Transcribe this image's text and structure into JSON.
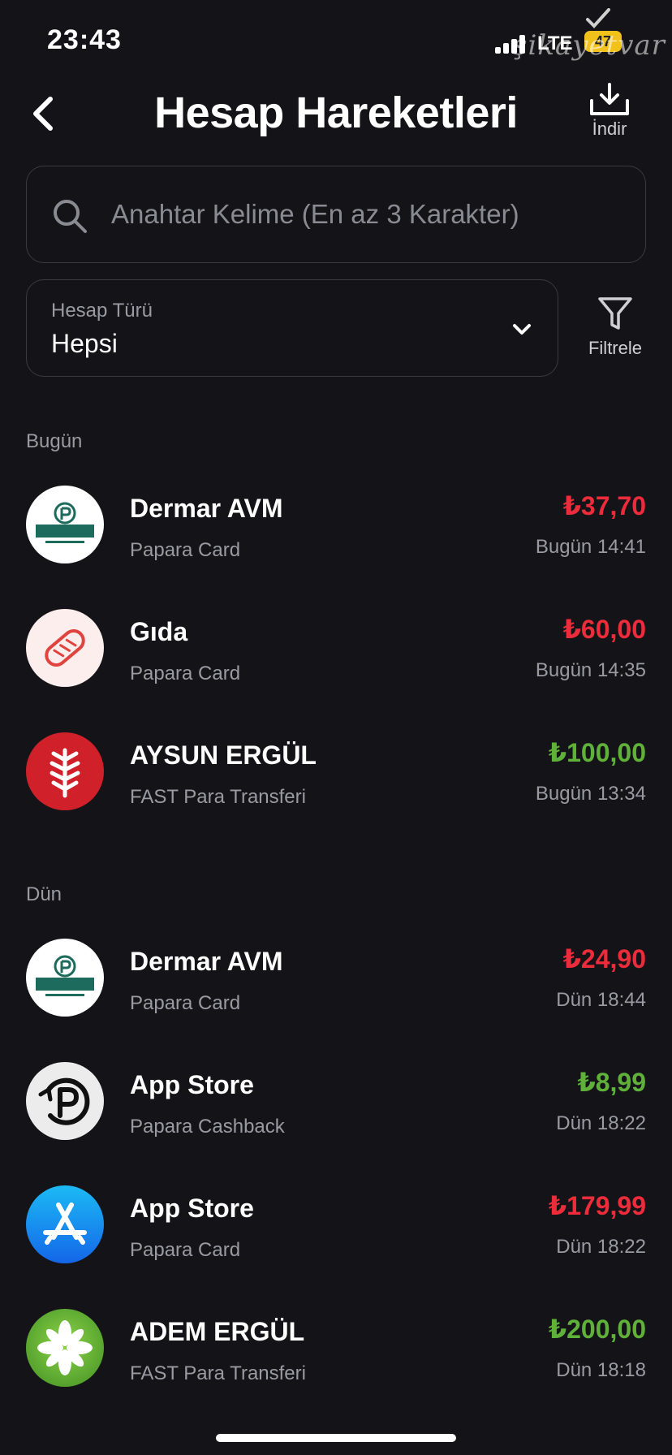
{
  "status_bar": {
    "time": "23:43",
    "network": "LTE",
    "battery": "47",
    "watermark": "şikayetvar"
  },
  "header": {
    "title": "Hesap Hareketleri",
    "download_label": "İndir"
  },
  "search": {
    "placeholder": "Anahtar Kelime (En az 3 Karakter)",
    "value": ""
  },
  "account_filter": {
    "label": "Hesap Türü",
    "selected": "Hepsi",
    "filter_label": "Filtrele"
  },
  "colors": {
    "background": "#141418",
    "negative": "#ec2c3a",
    "positive": "#5fb13a",
    "muted_text": "#9a9aa2",
    "border": "#3a3a42"
  },
  "sections": [
    {
      "title": "Bugün",
      "transactions": [
        {
          "name": "Dermar AVM",
          "type": "Papara Card",
          "amount": "₺37,70",
          "direction": "negative",
          "time": "Bugün 14:41",
          "icon": "dermar-logo"
        },
        {
          "name": "Gıda",
          "type": "Papara Card",
          "amount": "₺60,00",
          "direction": "negative",
          "time": "Bugün 14:35",
          "icon": "bread-icon"
        },
        {
          "name": "AYSUN ERGÜL",
          "type": "FAST Para Transferi",
          "amount": "₺100,00",
          "direction": "positive",
          "time": "Bugün 13:34",
          "icon": "bank-wheat-logo"
        }
      ]
    },
    {
      "title": "Dün",
      "transactions": [
        {
          "name": "Dermar AVM",
          "type": "Papara Card",
          "amount": "₺24,90",
          "direction": "negative",
          "time": "Dün 18:44",
          "icon": "dermar-logo"
        },
        {
          "name": "App Store",
          "type": "Papara Cashback",
          "amount": "₺8,99",
          "direction": "positive",
          "time": "Dün 18:22",
          "icon": "papara-cashback-icon"
        },
        {
          "name": "App Store",
          "type": "Papara Card",
          "amount": "₺179,99",
          "direction": "negative",
          "time": "Dün 18:22",
          "icon": "app-store-icon"
        },
        {
          "name": "ADEM ERGÜL",
          "type": "FAST Para Transferi",
          "amount": "₺200,00",
          "direction": "positive",
          "time": "Dün 18:18",
          "icon": "bank-clover-logo"
        }
      ]
    }
  ]
}
